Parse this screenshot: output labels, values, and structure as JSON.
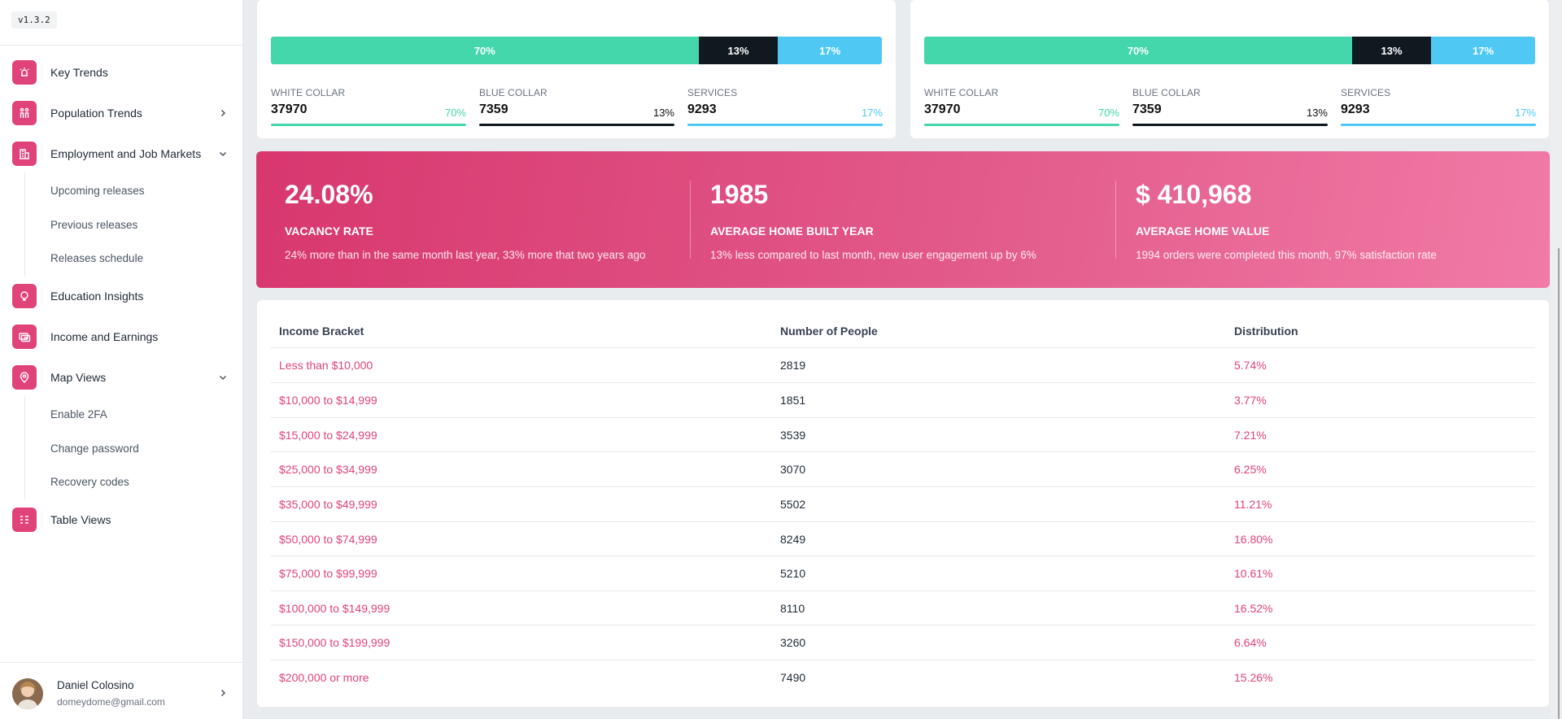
{
  "app": {
    "version": "v1.3.2"
  },
  "colors": {
    "accent": "#e0427a",
    "white_collar": "#44d7ab",
    "blue_collar": "#101820",
    "services": "#4fc9f4"
  },
  "sidebar": {
    "items": [
      {
        "label": "Key Trends",
        "icon": "alarm-icon"
      },
      {
        "label": "Population Trends",
        "icon": "people-icon",
        "chevron": "right"
      },
      {
        "label": "Employment and Job Markets",
        "icon": "building-icon",
        "chevron": "down",
        "subitems": [
          "Upcoming releases",
          "Previous releases",
          "Releases schedule"
        ]
      },
      {
        "label": "Education Insights",
        "icon": "education-icon"
      },
      {
        "label": "Income and Earnings",
        "icon": "money-icon"
      },
      {
        "label": "Map Views",
        "icon": "map-pin-icon",
        "chevron": "down",
        "subitems": [
          "Enable 2FA",
          "Change password",
          "Recovery codes"
        ]
      },
      {
        "label": "Table Views",
        "icon": "table-icon"
      }
    ],
    "user": {
      "name": "Daniel Colosino",
      "email": "domeydome@gmail.com"
    }
  },
  "workforce_cards": [
    {
      "segments": [
        {
          "label": "70%",
          "share": 70
        },
        {
          "label": "13%",
          "share": 13
        },
        {
          "label": "17%",
          "share": 17
        }
      ],
      "stats": [
        {
          "title": "WHITE COLLAR",
          "value": "37970",
          "pct": "70%"
        },
        {
          "title": "BLUE COLLAR",
          "value": "7359",
          "pct": "13%"
        },
        {
          "title": "SERVICES",
          "value": "9293",
          "pct": "17%"
        }
      ]
    },
    {
      "segments": [
        {
          "label": "70%",
          "share": 70
        },
        {
          "label": "13%",
          "share": 13
        },
        {
          "label": "17%",
          "share": 17
        }
      ],
      "stats": [
        {
          "title": "WHITE COLLAR",
          "value": "37970",
          "pct": "70%"
        },
        {
          "title": "BLUE COLLAR",
          "value": "7359",
          "pct": "13%"
        },
        {
          "title": "SERVICES",
          "value": "9293",
          "pct": "17%"
        }
      ]
    }
  ],
  "kpis": [
    {
      "value": "24.08%",
      "label": "VACANCY RATE",
      "desc": "24% more than in the same month last year, 33% more that two years ago"
    },
    {
      "value": "1985",
      "label": "AVERAGE HOME BUILT YEAR",
      "desc": "13% less compared to last month, new user engagement up by 6%"
    },
    {
      "value": "$ 410,968",
      "label": "AVERAGE HOME VALUE",
      "desc": "1994 orders were completed this month, 97% satisfaction rate"
    }
  ],
  "income_table": {
    "headers": [
      "Income Bracket",
      "Number of People",
      "Distribution"
    ],
    "rows": [
      [
        "Less than $10,000",
        "2819",
        "5.74%"
      ],
      [
        "$10,000 to $14,999",
        "1851",
        "3.77%"
      ],
      [
        "$15,000 to $24,999",
        "3539",
        "7.21%"
      ],
      [
        "$25,000 to $34,999",
        "3070",
        "6.25%"
      ],
      [
        "$35,000 to $49,999",
        "5502",
        "11.21%"
      ],
      [
        "$50,000 to $74,999",
        "8249",
        "16.80%"
      ],
      [
        "$75,000 to $99,999",
        "5210",
        "10.61%"
      ],
      [
        "$100,000 to $149,999",
        "8110",
        "16.52%"
      ],
      [
        "$150,000 to $199,999",
        "3260",
        "6.64%"
      ],
      [
        "$200,000 or more",
        "7490",
        "15.26%"
      ]
    ]
  }
}
